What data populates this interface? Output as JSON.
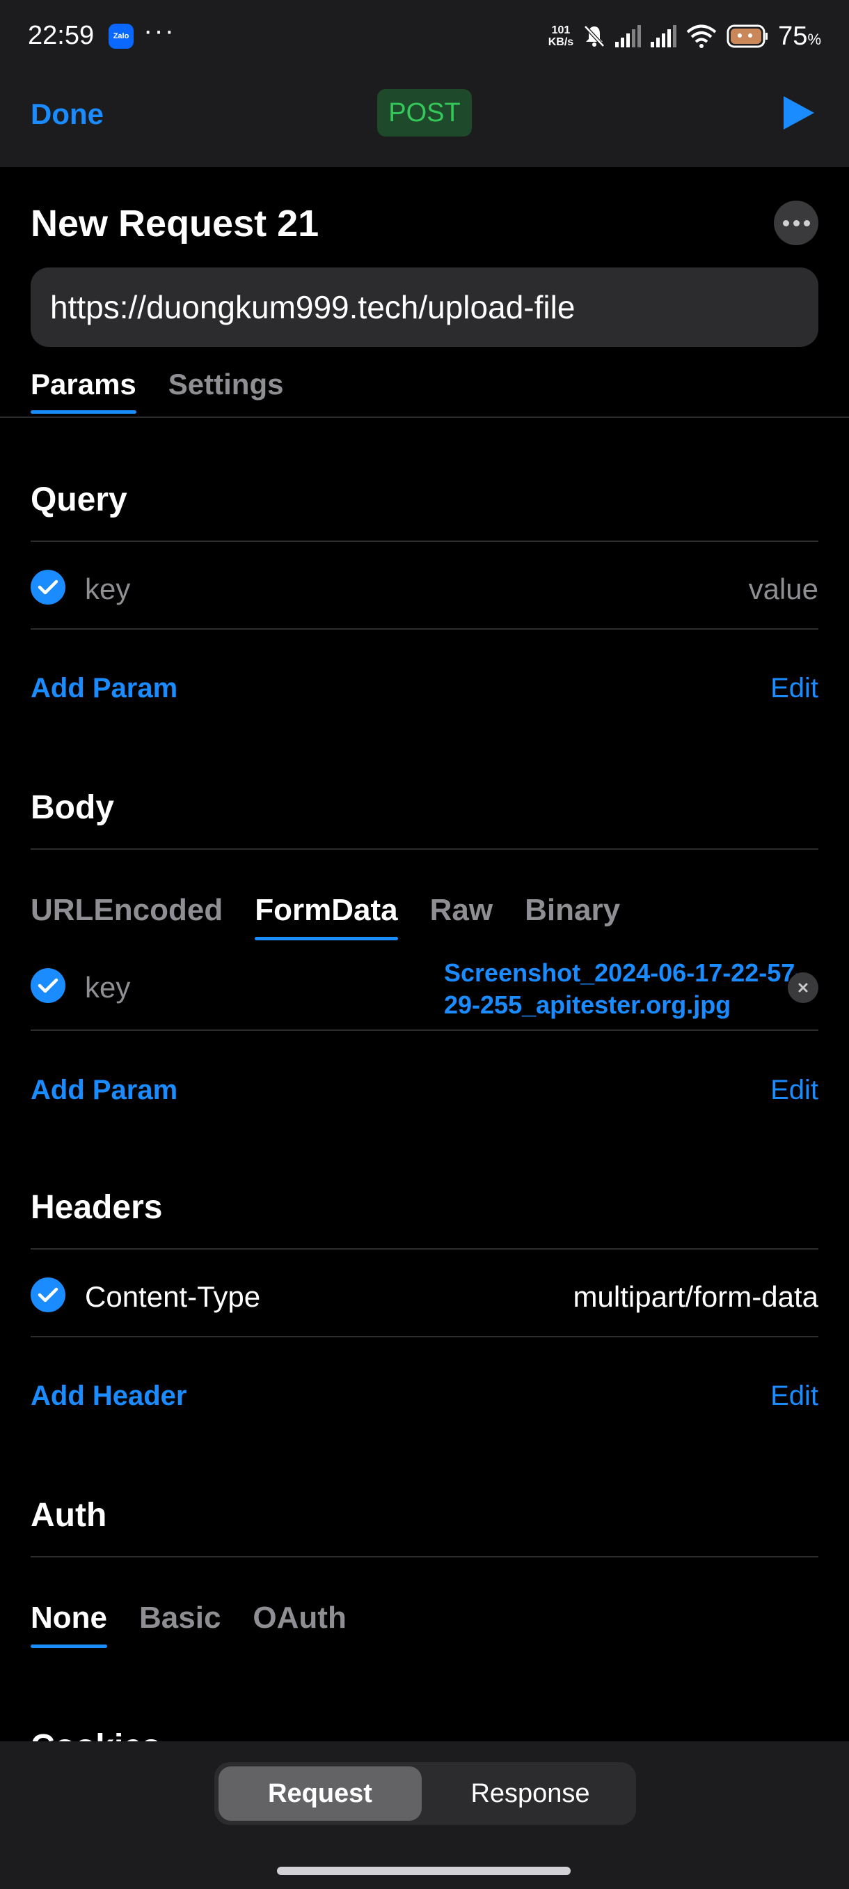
{
  "status_bar": {
    "time": "22:59",
    "app_icon": "Zalo",
    "more": "···",
    "net_speed_top": "101",
    "net_speed_bottom": "KB/s",
    "battery": "75",
    "battery_unit": "%"
  },
  "navbar": {
    "done_label": "Done",
    "method": "POST"
  },
  "request": {
    "title": "New Request 21",
    "url": "https://duongkum999.tech/upload-file"
  },
  "top_tabs": {
    "params": "Params",
    "settings": "Settings"
  },
  "query": {
    "title": "Query",
    "row": {
      "key": "key",
      "value": "value"
    },
    "add_label": "Add Param",
    "edit_label": "Edit"
  },
  "body": {
    "title": "Body",
    "tabs": [
      "URLEncoded",
      "FormData",
      "Raw",
      "Binary"
    ],
    "row": {
      "key": "key",
      "file": "Screenshot_2024-06-17-22-57-29-255_apitester.org.jpg"
    },
    "add_label": "Add Param",
    "edit_label": "Edit"
  },
  "headers": {
    "title": "Headers",
    "row": {
      "key": "Content-Type",
      "value": "multipart/form-data"
    },
    "add_label": "Add Header",
    "edit_label": "Edit"
  },
  "auth": {
    "title": "Auth",
    "tabs": [
      "None",
      "Basic",
      "OAuth"
    ]
  },
  "cut_section_title": "Cookies",
  "bottom": {
    "request": "Request",
    "response": "Response"
  },
  "colors": {
    "accent": "#1a8cff",
    "post_green": "#34c759"
  }
}
